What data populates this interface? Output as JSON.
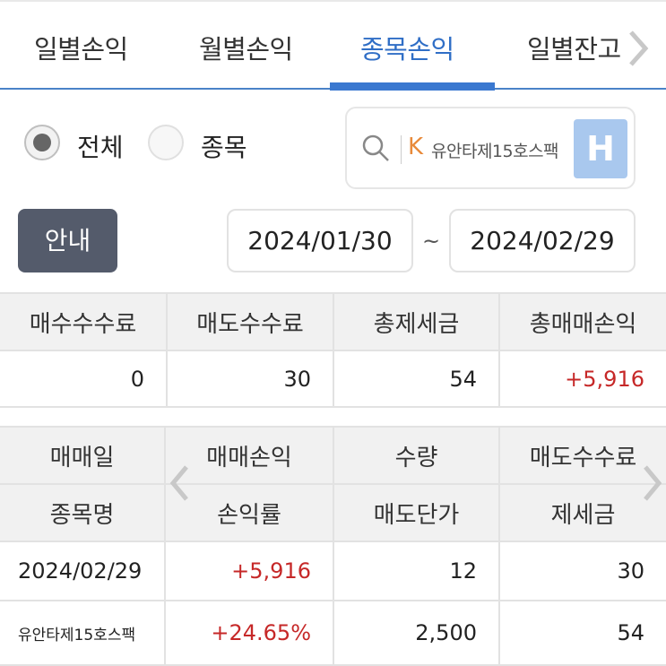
{
  "tabs": [
    {
      "label": "일별손익",
      "active": false
    },
    {
      "label": "월별손익",
      "active": false
    },
    {
      "label": "종목손익",
      "active": true
    },
    {
      "label": "일별잔고",
      "active": false
    }
  ],
  "filter": {
    "options": [
      {
        "label": "전체",
        "selected": true
      },
      {
        "label": "종목",
        "selected": false
      }
    ]
  },
  "search": {
    "market_badge": "K",
    "value": "유안타제15호스팩",
    "h_button": "H"
  },
  "guide_button": "안내",
  "date_range": {
    "start": "2024/01/30",
    "separator": "~",
    "end": "2024/02/29"
  },
  "summary": {
    "headers": [
      "매수수수료",
      "매도수수료",
      "총제세금",
      "총매매손익"
    ],
    "values": [
      "0",
      "30",
      "54",
      "+5,916"
    ]
  },
  "detail": {
    "header_row1": [
      "매매일",
      "매매손익",
      "수량",
      "매도수수료"
    ],
    "header_row2": [
      "종목명",
      "손익률",
      "매도단가",
      "제세금"
    ],
    "row1": [
      "2024/02/29",
      "+5,916",
      "12",
      "30"
    ],
    "row2": [
      "유안타제15호스팩",
      "+24.65%",
      "2,500",
      "54"
    ]
  },
  "colors": {
    "accent": "#2f6ec6",
    "profit": "#c62828",
    "header_bg": "#f1f1f1",
    "guide_bg": "#545b6b",
    "h_badge_bg": "#a9c8ee",
    "k_badge": "#e88a3a"
  },
  "icons": [
    "chevron-right-icon",
    "search-icon",
    "chevron-left-icon"
  ]
}
